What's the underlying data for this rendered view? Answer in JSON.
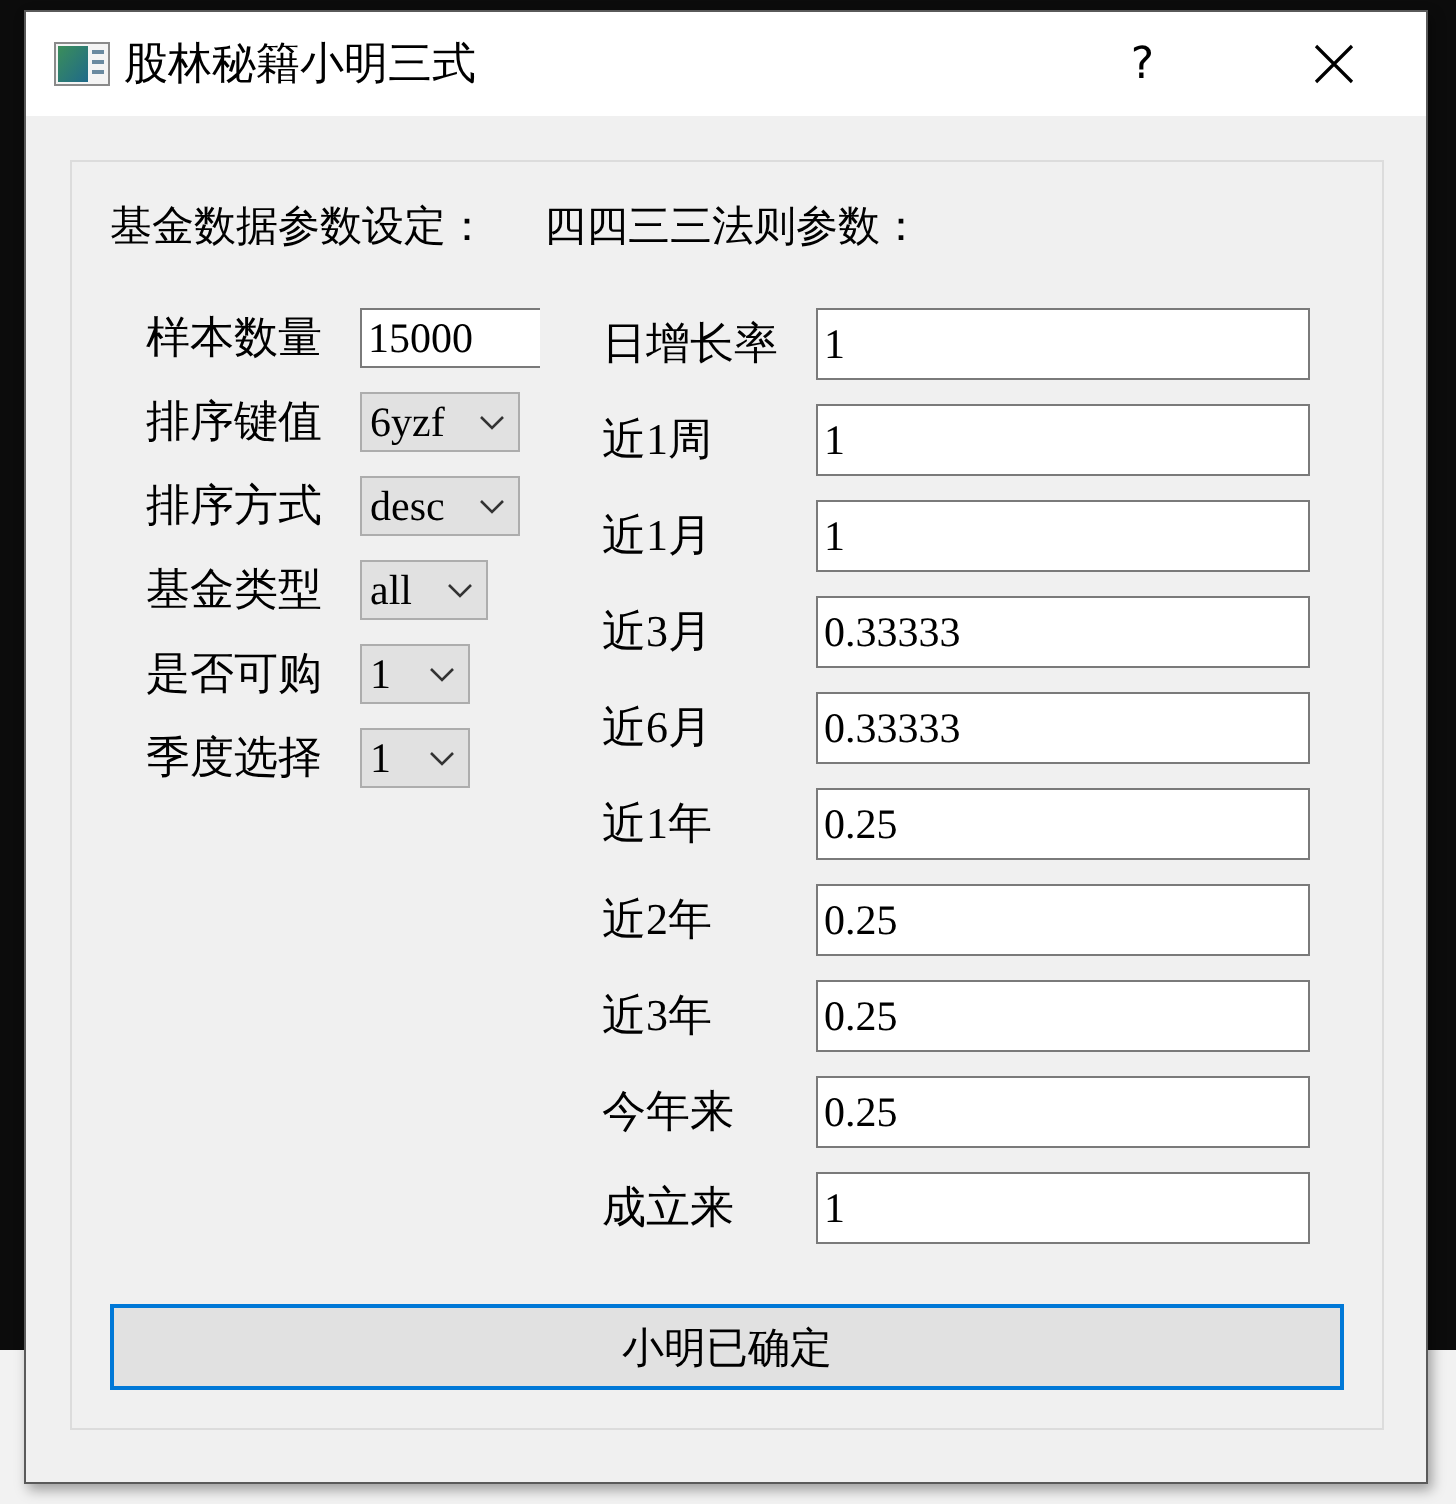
{
  "window": {
    "title": "股林秘籍小明三式",
    "help": "?"
  },
  "headings": [
    "基金数据参数设定：",
    "四四三三法则参数："
  ],
  "data_settings": [
    {
      "label": "样本数量",
      "kind": "input",
      "value": "15000"
    },
    {
      "label": "排序键值",
      "kind": "combo",
      "value": "6yzf"
    },
    {
      "label": "排序方式",
      "kind": "combo",
      "value": "desc"
    },
    {
      "label": "基金类型",
      "kind": "combo",
      "value": "all"
    },
    {
      "label": "是否可购",
      "kind": "combo",
      "value": "1"
    },
    {
      "label": "季度选择",
      "kind": "combo",
      "value": "1"
    }
  ],
  "rule_params": [
    {
      "label": "日增长率",
      "value": "1"
    },
    {
      "label": "近1周",
      "value": "1"
    },
    {
      "label": "近1月",
      "value": "1"
    },
    {
      "label": "近3月",
      "value": "0.33333"
    },
    {
      "label": "近6月",
      "value": "0.33333"
    },
    {
      "label": "近1年",
      "value": "0.25"
    },
    {
      "label": "近2年",
      "value": "0.25"
    },
    {
      "label": "近3年",
      "value": "0.25"
    },
    {
      "label": "今年来",
      "value": "0.25"
    },
    {
      "label": "成立来",
      "value": "1"
    }
  ],
  "confirm_button": "小明已确定"
}
